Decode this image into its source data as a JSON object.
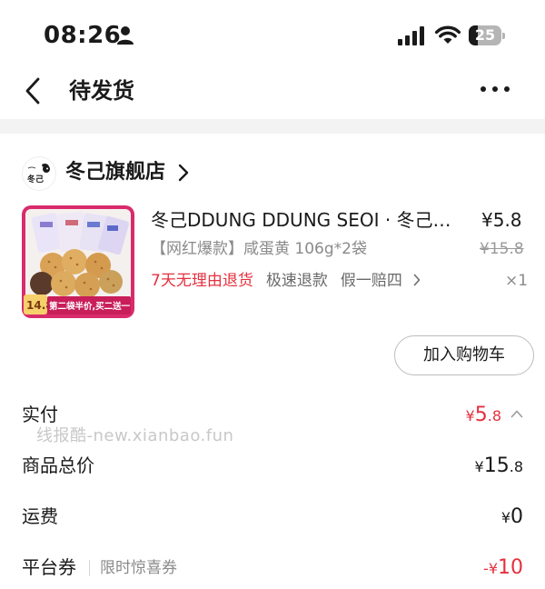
{
  "status_bar": {
    "time": "08:26",
    "battery": "25",
    "icons": [
      "person-icon",
      "signal-icon",
      "wifi-icon",
      "battery-icon"
    ]
  },
  "nav": {
    "title": "待发货",
    "icons": [
      "back-icon",
      "more-icon"
    ]
  },
  "shop": {
    "logo_text": "冬己",
    "name": "冬己旗舰店"
  },
  "product": {
    "title": "冬己DDUNG DDUNG SEOI · 冬己…",
    "price": "¥5.8",
    "spec": "【网红爆款】咸蛋黄 106g*2袋",
    "original_price": "¥15.8",
    "quantity": "×1",
    "service_tags": [
      "7天无理由退货",
      "极速退款",
      "假一赔四"
    ],
    "thumb_badge_price": "14.8",
    "thumb_banner": "第二袋半价,买二送一"
  },
  "actions": {
    "add_to_cart": "加入购物车"
  },
  "summary": {
    "paid": {
      "label": "实付",
      "currency": "¥",
      "int": "5",
      "dec": ".8"
    },
    "goods_total": {
      "label": "商品总价",
      "currency": "¥",
      "int": "15",
      "dec": ".8"
    },
    "shipping": {
      "label": "运费",
      "currency": "¥",
      "int": "0"
    },
    "coupon": {
      "label": "平台券",
      "sub": "限时惊喜券",
      "prefix": "-¥",
      "int": "10"
    }
  },
  "watermark": "线报酷-new.xianbao.fun",
  "colors": {
    "accent_red": "#e5303f",
    "gray_text": "#8a8a8a",
    "band": "#f3f3f3"
  }
}
